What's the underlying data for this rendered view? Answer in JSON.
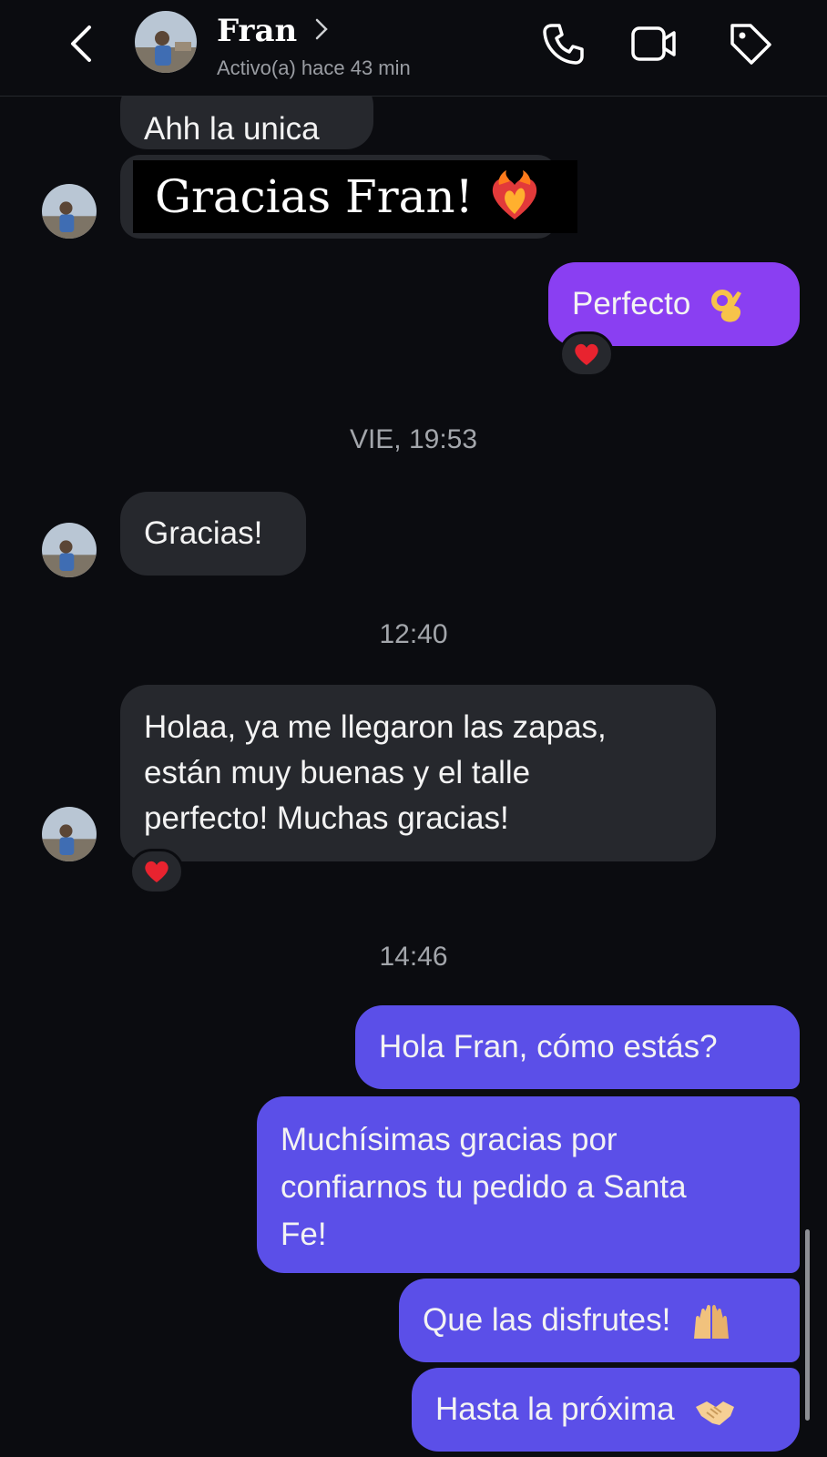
{
  "header": {
    "contact_name": "Fran",
    "status": "Activo(a) hace 43 min"
  },
  "messages": {
    "m1": "Ahh la unica",
    "overlay_caption": "Gracias Fran!",
    "m2": "Perfecto",
    "ts1": "VIE, 19:53",
    "m3": "Gracias!",
    "ts2": "12:40",
    "m4_line1": "Holaa, ya me llegaron las zapas,",
    "m4_line2": "están muy buenas y el talle",
    "m4_line3": "perfecto! Muchas gracias!",
    "ts3": "14:46",
    "m5": "Hola Fran, cómo estás?",
    "m6_line1": "Muchísimas gracias por",
    "m6_line2": "confiarnos tu pedido a Santa",
    "m6_line3": "Fe!",
    "m7": "Que las disfrutes!",
    "m8": "Hasta la próxima"
  },
  "colors": {
    "background": "#0b0c10",
    "incoming_bubble": "#26282d",
    "outgoing_bubble": "#5b4fe8",
    "outgoing_bubble_top": "#8a3ff2"
  },
  "icons": {
    "back": "chevron-left-icon",
    "phone": "phone-icon",
    "video": "video-icon",
    "tag": "tag-icon",
    "ok_hand": "ok-hand-emoji",
    "heart": "red-heart-emoji",
    "heart_on_fire": "heart-on-fire-emoji",
    "raised_hands": "raised-hands-emoji",
    "handshake": "handshake-emoji"
  }
}
